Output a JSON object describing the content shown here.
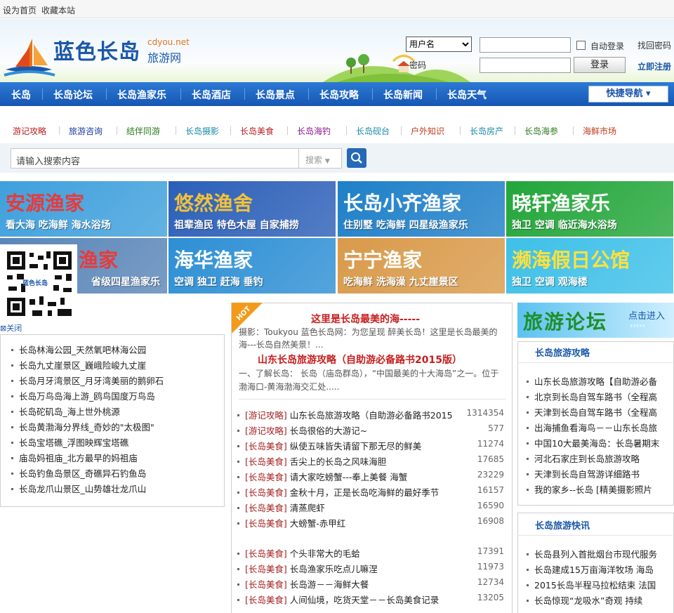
{
  "topbar": {
    "set_home": "设为首页",
    "bookmark": "收藏本站"
  },
  "logo": {
    "main": "蓝色长岛",
    "domain": "cdyou.net",
    "sub": "旅游网"
  },
  "login": {
    "select_value": "用户名",
    "password_label": "密码",
    "auto_login": "自动登录",
    "forgot": "找回密码",
    "register": "立即注册",
    "submit": "登录"
  },
  "nav": [
    "长岛",
    "长岛论坛",
    "长岛渔家乐",
    "长岛酒店",
    "长岛景点",
    "长岛攻略",
    "长岛新闻",
    "长岛天气"
  ],
  "quick_nav": "快捷导航",
  "subnav": [
    {
      "label": "游记攻略",
      "color": "#b81d1d"
    },
    {
      "label": "旅游咨询",
      "color": "#1a3c9a"
    },
    {
      "label": "结伴同游",
      "color": "#2a7a1a"
    },
    {
      "label": "长岛摄影",
      "color": "#1a8aa8"
    },
    {
      "label": "长岛美食",
      "color": "#b81d1d"
    },
    {
      "label": "长岛海钓",
      "color": "#8a1a8a"
    },
    {
      "label": "长岛砚台",
      "color": "#1a8aa8"
    },
    {
      "label": "户外知识",
      "color": "#c0391a"
    },
    {
      "label": "长岛房产",
      "color": "#1a8aa8"
    },
    {
      "label": "长岛海参",
      "color": "#2a7a1a"
    },
    {
      "label": "海鲜市场",
      "color": "#c0391a"
    }
  ],
  "search": {
    "placeholder": "请输入搜索内容",
    "type": "搜索"
  },
  "banners": [
    {
      "title": "安源渔家",
      "slogan": "看大海 吃海鲜 海水浴场",
      "bg": "#3fa0dc"
    },
    {
      "title": "悠然渔舍",
      "slogan": "祖辈渔民 特色木屋 自家捕捞",
      "bg": "#2b5fb8"
    },
    {
      "title": "长岛小齐渔家",
      "slogan": "住别墅 吃海鲜 四星级渔家乐",
      "bg": "#1e7fc8"
    },
    {
      "title": "晓轩渔家乐",
      "slogan": "独卫 空调  临近海水浴场",
      "bg": "#23a63a"
    },
    {
      "title": "渔家",
      "slogan": "省级四星渔家乐",
      "bg": "#5a86b8"
    },
    {
      "title": "海华渔家",
      "slogan": "空调 独卫 赶海 垂钓",
      "bg": "#2d8fd4"
    },
    {
      "title": "宁宁渔家",
      "slogan": "吃海鲜 洗海澡 九丈崖景区",
      "bg": "#d99a4a"
    },
    {
      "title": "濒海假日公馆",
      "slogan": "独卫 空调 观海楼",
      "bg": "#3ec0e8"
    }
  ],
  "qr": {
    "label": "蓝色长岛",
    "close": "关闭"
  },
  "left_list": [
    "长岛林海公园_天然氧吧林海公园",
    "长岛九丈崖景区_巍峨险峻九丈崖",
    "长岛月牙湾景区_月牙湾美丽的鹅卵石",
    "长岛万鸟岛海上游_鸥鸟国度万鸟岛",
    "长岛砣矶岛_海上世外桃源",
    "长岛黄渤海分界线_奇妙的\"太极图\"",
    "长岛宝塔礁_浮图映辉宝塔礁",
    "庙岛妈祖庙_北方最早的妈祖庙",
    "长岛钓鱼岛景区_奇礁异石钓鱼岛",
    "长岛龙爪山景区_山势雄壮龙爪山"
  ],
  "center": {
    "hot": "HOT",
    "headline1": "这里是长岛最美的海-----",
    "desc1": "摄影：Toukyou 蓝色长岛网：为您呈现  醉美长岛！这里是长岛最美的海---长岛自然美景！...",
    "headline2": "山东长岛旅游攻略（自助游必备路书2015版）",
    "desc2": "一、了解长岛：  长岛（庙岛群岛），“中国最美的十大海岛”之一。位于渤海口-黄海渤海交汇处.....",
    "list1": [
      {
        "cat": "[游记攻略]",
        "title": "山东长岛旅游攻略（自助游必备路书2015",
        "num": "1314354"
      },
      {
        "cat": "[游记攻略]",
        "title": "长岛很俗的大游记~",
        "num": "577"
      },
      {
        "cat": "[长岛美食]",
        "title": "纵使五味皆失请留下那无尽的鲜美",
        "num": "11274"
      },
      {
        "cat": "[长岛美食]",
        "title": "舌尖上的长岛之风味海胆",
        "num": "17685"
      },
      {
        "cat": "[长岛美食]",
        "title": "请大家吃螃蟹---奉上美餐  海蟹",
        "num": "23229"
      },
      {
        "cat": "[长岛美食]",
        "title": "金秋十月，正是长岛吃海鲜的最好季节",
        "num": "16157"
      },
      {
        "cat": "[长岛美食]",
        "title": "清蒸爬虾",
        "num": "16590"
      },
      {
        "cat": "[长岛美食]",
        "title": "大螃蟹-赤甲红",
        "num": "16908"
      }
    ],
    "list2": [
      {
        "cat": "[长岛美食]",
        "title": "个头非常大的毛蛤",
        "num": "17391"
      },
      {
        "cat": "[长岛美食]",
        "title": "长岛渔家乐吃点儿嘛涅",
        "num": "11973"
      },
      {
        "cat": "[长岛美食]",
        "title": "长岛游－－海鲜大餐",
        "num": "12734"
      },
      {
        "cat": "[长岛美食]",
        "title": "人间仙境，吃货天堂－－长岛美食记录",
        "num": "13205"
      }
    ]
  },
  "right": {
    "forum_banner": "旅游论坛",
    "forum_enter": "点击进入",
    "guide_title": "长岛旅游攻略",
    "guide_list": [
      "山东长岛旅游攻略【自助游必备",
      "北京到长岛自驾车路书（全程高",
      "天津到长岛自驾车路书（全程高",
      "出海捕鱼看海鸟－－山东长岛旅",
      "中国10大最美海岛：长岛暑期末",
      "河北石家庄到长岛旅游攻略",
      "天津到长岛自驾游详细路书",
      "我的家乡--长岛 [精美摄影照片"
    ],
    "news_title": "长岛旅游快讯",
    "news_list": [
      "长岛县列入首批烟台市现代服务",
      "长岛建成15万亩海洋牧场  海岛",
      "2015长岛半程马拉松结束  法国",
      "长岛惊现“龙吸水”奇观  持续"
    ]
  }
}
